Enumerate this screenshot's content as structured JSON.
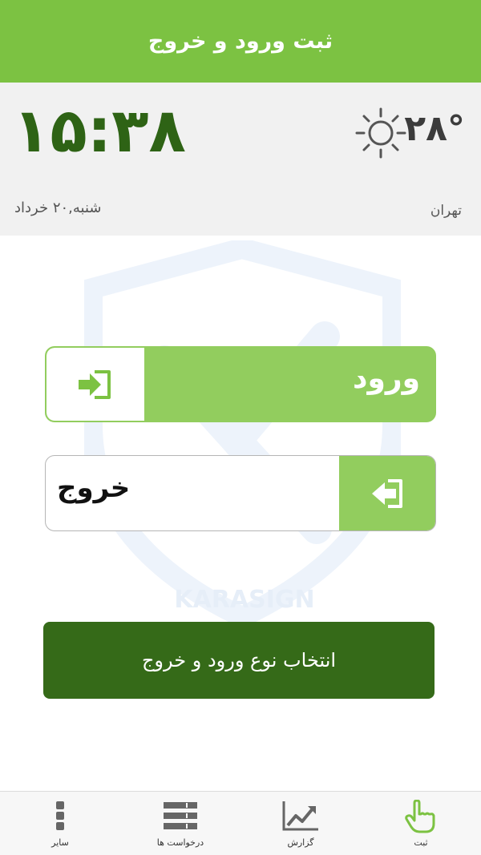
{
  "header": {
    "title": "ثبت ورود و خروج"
  },
  "info": {
    "time": "۱۵:۳۸",
    "date": "شنبه,۲۰ خرداد",
    "temperature": "۲۸°",
    "city": "تهران"
  },
  "actions": {
    "enter_label": "ورود",
    "exit_label": "خروج",
    "select_label": "انتخاب نوع ورود و خروج"
  },
  "watermark": {
    "brand": "KARASIGN"
  },
  "nav": {
    "items": [
      {
        "label": "سایر",
        "icon": "more-vertical-icon"
      },
      {
        "label": "درخواست ها",
        "icon": "list-icon"
      },
      {
        "label": "گزارش",
        "icon": "chart-icon"
      },
      {
        "label": "ثبت",
        "icon": "hand-pointer-icon"
      }
    ]
  },
  "colors": {
    "brand_green": "#7cc242",
    "light_green": "#92cd5e",
    "dark_green": "#356a18",
    "clock_green": "#2e6315"
  }
}
